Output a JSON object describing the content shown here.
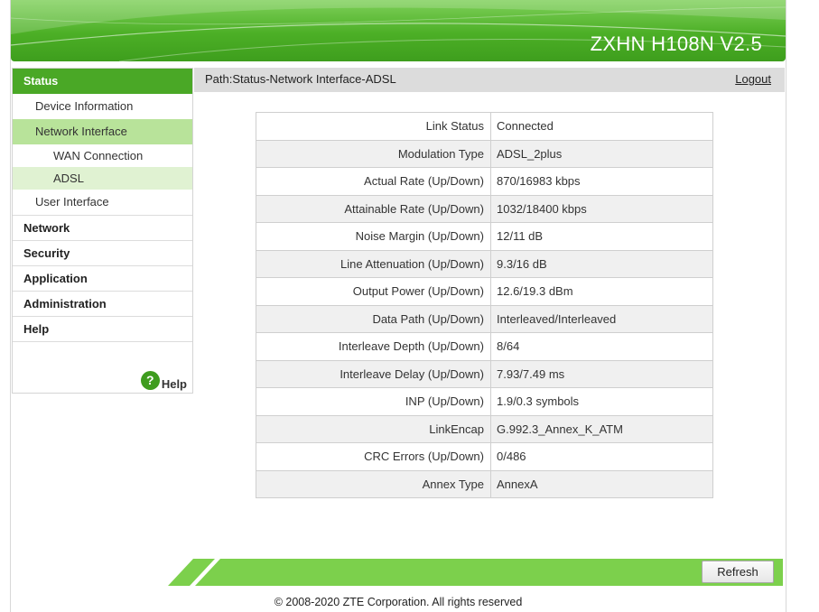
{
  "header": {
    "model": "ZXHN H108N V2.5"
  },
  "sidebar": {
    "status": "Status",
    "device_information": "Device Information",
    "network_interface": "Network Interface",
    "wan_connection": "WAN Connection",
    "adsl": "ADSL",
    "user_interface": "User Interface",
    "network": "Network",
    "security": "Security",
    "application": "Application",
    "administration": "Administration",
    "help": "Help",
    "help_icon_glyph": "?",
    "help_label": "Help"
  },
  "path": {
    "text": "Path:Status-Network Interface-ADSL",
    "logout": "Logout"
  },
  "rows": [
    {
      "label": "Link Status",
      "value": "Connected"
    },
    {
      "label": "Modulation Type",
      "value": "ADSL_2plus"
    },
    {
      "label": "Actual Rate (Up/Down)",
      "value": "870/16983 kbps"
    },
    {
      "label": "Attainable Rate (Up/Down)",
      "value": "1032/18400 kbps"
    },
    {
      "label": "Noise Margin (Up/Down)",
      "value": "12/11 dB"
    },
    {
      "label": "Line Attenuation (Up/Down)",
      "value": "9.3/16 dB"
    },
    {
      "label": "Output Power (Up/Down)",
      "value": "12.6/19.3 dBm"
    },
    {
      "label": "Data Path (Up/Down)",
      "value": "Interleaved/Interleaved"
    },
    {
      "label": "Interleave Depth (Up/Down)",
      "value": "8/64"
    },
    {
      "label": "Interleave Delay (Up/Down)",
      "value": "7.93/7.49 ms"
    },
    {
      "label": "INP (Up/Down)",
      "value": "1.9/0.3 symbols"
    },
    {
      "label": "LinkEncap",
      "value": "G.992.3_Annex_K_ATM"
    },
    {
      "label": "CRC Errors (Up/Down)",
      "value": "0/486"
    },
    {
      "label": "Annex Type",
      "value": "AnnexA"
    }
  ],
  "footer": {
    "refresh": "Refresh",
    "copyright": "© 2008-2020 ZTE Corporation. All rights reserved"
  },
  "colors": {
    "brand_green": "#4aa826",
    "light_green": "#b8e39a",
    "pale_green": "#e0f2d2"
  }
}
